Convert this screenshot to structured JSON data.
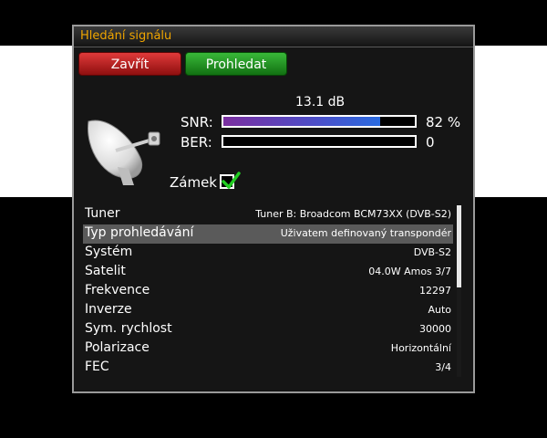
{
  "window": {
    "title": "Hledání signálu"
  },
  "buttons": {
    "close": "Zavřít",
    "scan": "Prohledat"
  },
  "signal": {
    "db": "13.1 dB",
    "snr_label": "SNR:",
    "snr_value": "82 %",
    "snr_fraction": 0.82,
    "ber_label": "BER:",
    "ber_value": "0",
    "ber_fraction": 0.0,
    "lock_label": "Zámek",
    "locked": true
  },
  "settings": [
    {
      "key": "Tuner",
      "value": "Tuner B: Broadcom BCM73XX (DVB-S2)"
    },
    {
      "key": "Typ prohledávání",
      "value": "Uživatem definovaný transpondér",
      "selected": true
    },
    {
      "key": "Systém",
      "value": "DVB-S2"
    },
    {
      "key": "Satelit",
      "value": "04.0W Amos 3/7"
    },
    {
      "key": "Frekvence",
      "value": "12297"
    },
    {
      "key": "Inverze",
      "value": "Auto"
    },
    {
      "key": "Sym. rychlost",
      "value": "30000"
    },
    {
      "key": "Polarizace",
      "value": "Horizontální"
    },
    {
      "key": "FEC",
      "value": "3/4"
    }
  ],
  "colors": {
    "title": "#f0a500",
    "close_button": "#c82020",
    "scan_button": "#2aa02a",
    "lock_check": "#22cc22"
  }
}
